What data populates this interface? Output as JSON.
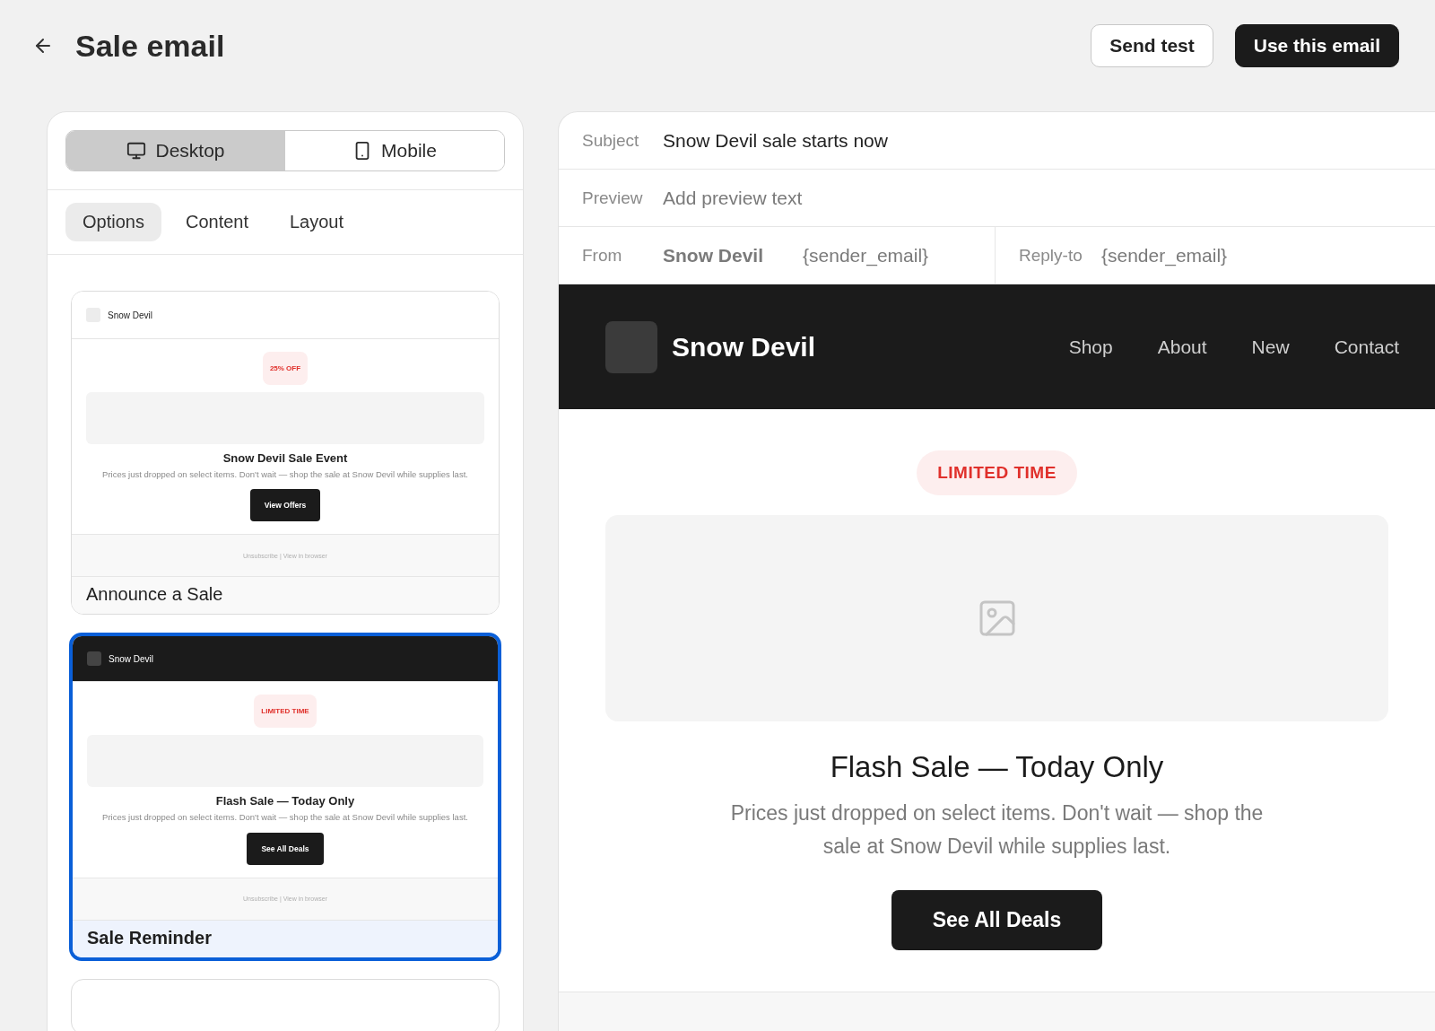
{
  "header": {
    "title": "Sale email",
    "actions": [
      {
        "label": "Send test",
        "kind": "secondary"
      },
      {
        "label": "Use this email",
        "kind": "primary"
      }
    ]
  },
  "device_toggle": [
    {
      "label": "Desktop",
      "kind": "desktop",
      "selected": true
    },
    {
      "label": "Mobile",
      "kind": "mobile",
      "selected": false
    }
  ],
  "tabs": [
    {
      "label": "Options",
      "selected": true
    },
    {
      "label": "Content",
      "selected": false
    },
    {
      "label": "Layout",
      "selected": false
    }
  ],
  "templates": [
    {
      "name": "Announce a Sale",
      "kind": "light",
      "selected": false,
      "brand": "Snow Devil",
      "badge": "25% OFF",
      "heading": "Snow Devil Sale Event",
      "body": "Prices just dropped on select items. Don't wait — shop the sale at Snow Devil while supplies last.",
      "button": "View Offers",
      "footer": "Unsubscribe | View in browser"
    },
    {
      "name": "Sale Reminder",
      "kind": "dark",
      "selected": true,
      "brand": "Snow Devil",
      "badge": "LIMITED TIME",
      "heading": "Flash Sale — Today Only",
      "body": "Prices just dropped on select items. Don't wait — shop the sale at Snow Devil while supplies last.",
      "button": "See All Deals",
      "footer": "Unsubscribe | View in browser"
    }
  ],
  "email": {
    "subject_label": "Subject",
    "subject": "Snow Devil sale starts now",
    "preview_label": "Preview",
    "preview_placeholder": "Add preview text",
    "from_label": "From",
    "from_name": "Snow Devil",
    "from_email": "{sender_email}",
    "reply_label": "Reply-to",
    "reply_email": "{sender_email}"
  },
  "preview": {
    "brand": "Snow Devil",
    "nav": [
      "Shop",
      "About",
      "New",
      "Contact"
    ],
    "badge": "LIMITED TIME",
    "heading": "Flash Sale — Today Only",
    "body": "Prices just dropped on select items. Don't wait — shop the sale at Snow Devil while supplies last.",
    "button": "See All Deals"
  }
}
